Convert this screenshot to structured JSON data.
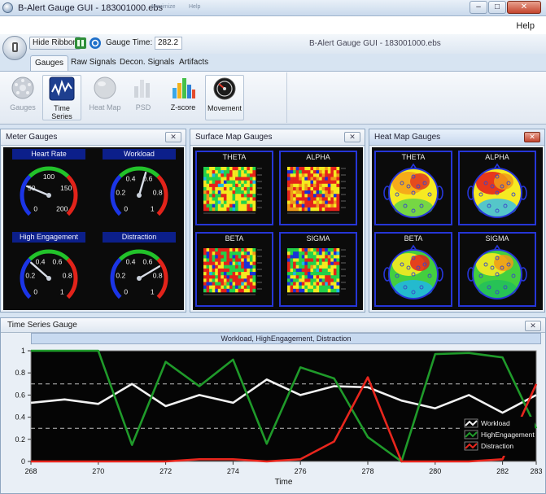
{
  "window": {
    "title": "B-Alert Gauge GUI  -  183001000.ebs",
    "title_ghost_a": "Maximize",
    "title_ghost_b": "Help",
    "min_label": "–",
    "max_label": "□",
    "close_label": "✕"
  },
  "menu": {
    "help_label": "Help"
  },
  "ribbon": {
    "hide_ribbon_label": "Hide Ribbon",
    "gauge_time_label": "Gauge Time:",
    "gauge_time_value": "282.2",
    "document_title": "B-Alert Gauge GUI  -  183001000.ebs",
    "tabs": [
      {
        "label": "Gauges",
        "active": true
      },
      {
        "label": "Raw Signals",
        "active": false
      },
      {
        "label": "Decon. Signals",
        "active": false
      },
      {
        "label": "Artifacts",
        "active": false
      }
    ],
    "buttons": [
      {
        "label": "Gauges",
        "icon": "gauges-icon",
        "enabled": false
      },
      {
        "label": "Time Series",
        "icon": "time-series-icon",
        "enabled": true
      },
      {
        "label": "Heat Map",
        "icon": "heat-map-icon",
        "enabled": false
      },
      {
        "label": "PSD",
        "icon": "psd-icon",
        "enabled": false
      },
      {
        "label": "Z-score",
        "icon": "z-score-icon",
        "enabled": true
      },
      {
        "label": "Movement",
        "icon": "movement-icon",
        "enabled": true
      }
    ]
  },
  "panels": {
    "close_label": "✕",
    "meter": {
      "title": "Meter Gauges",
      "gauges": [
        {
          "label": "Heart Rate",
          "ticks": [
            "0",
            "50",
            "100",
            "150",
            "200"
          ],
          "value": 50,
          "min": 0,
          "max": 200
        },
        {
          "label": "Workload",
          "ticks": [
            "0",
            "0.2",
            "0.4",
            "0.6",
            "0.8",
            "1"
          ],
          "value": 0.56,
          "min": 0,
          "max": 1
        },
        {
          "label": "High Engagement",
          "ticks": [
            "0",
            "0.2",
            "0.4",
            "0.6",
            "0.8",
            "1"
          ],
          "value": 0.32,
          "min": 0,
          "max": 1
        },
        {
          "label": "Distraction",
          "ticks": [
            "0",
            "0.2",
            "0.4",
            "0.6",
            "0.8",
            "1"
          ],
          "value": 0.72,
          "min": 0,
          "max": 1
        }
      ]
    },
    "surface": {
      "title": "Surface Map Gauges",
      "maps": [
        {
          "label": "THETA"
        },
        {
          "label": "ALPHA"
        },
        {
          "label": "BETA"
        },
        {
          "label": "SIGMA"
        }
      ]
    },
    "heat": {
      "title": "Heat Map Gauges",
      "maps": [
        {
          "label": "THETA"
        },
        {
          "label": "ALPHA"
        },
        {
          "label": "BETA"
        },
        {
          "label": "SIGMA"
        }
      ]
    },
    "timeseries": {
      "title": "Time Series Gauge",
      "chart_title": "Workload, HighEngagement, Distraction"
    }
  },
  "colors": {
    "workload": "#f2f2f2",
    "engagement": "#1f9a2a",
    "distraction": "#e8261d",
    "gauge_blue": "#1b35e6",
    "gauge_green": "#22c22a",
    "gauge_red": "#e2231a",
    "map_border": "#2636d8"
  },
  "chart_data": {
    "type": "line",
    "title": "Workload, HighEngagement, Distraction",
    "xlabel": "Time",
    "ylabel": "",
    "xlim": [
      268,
      283
    ],
    "ylim": [
      0,
      1
    ],
    "xticks": [
      268,
      270,
      272,
      274,
      276,
      278,
      280,
      282,
      283
    ],
    "yticks": [
      0,
      0.2,
      0.4,
      0.6,
      0.8,
      1
    ],
    "threshold_lines": [
      0.3,
      0.7
    ],
    "legend_position": "bottom-right",
    "grid": false,
    "series": [
      {
        "name": "Workload",
        "color": "#f2f2f2",
        "x": [
          268,
          269,
          270,
          271,
          272,
          273,
          274,
          275,
          276,
          277,
          278,
          279,
          280,
          281,
          282,
          283
        ],
        "y": [
          0.53,
          0.56,
          0.52,
          0.7,
          0.5,
          0.6,
          0.53,
          0.74,
          0.6,
          0.68,
          0.67,
          0.55,
          0.48,
          0.6,
          0.44,
          0.6
        ]
      },
      {
        "name": "HighEngagement",
        "color": "#1f9a2a",
        "x": [
          268,
          269,
          270,
          271,
          272,
          273,
          274,
          275,
          276,
          277,
          278,
          279,
          280,
          281,
          282,
          283
        ],
        "y": [
          1.0,
          1.0,
          1.0,
          0.15,
          0.9,
          0.68,
          0.92,
          0.16,
          0.85,
          0.75,
          0.22,
          0.0,
          0.97,
          0.98,
          0.94,
          0.3
        ]
      },
      {
        "name": "Distraction",
        "color": "#e8261d",
        "x": [
          268,
          269,
          270,
          271,
          272,
          273,
          274,
          275,
          276,
          277,
          278,
          279,
          280,
          281,
          282,
          283
        ],
        "y": [
          0.0,
          0.0,
          0.0,
          0.0,
          0.0,
          0.02,
          0.02,
          0.0,
          0.02,
          0.18,
          0.76,
          0.0,
          0.0,
          0.0,
          0.02,
          0.7
        ]
      }
    ]
  }
}
